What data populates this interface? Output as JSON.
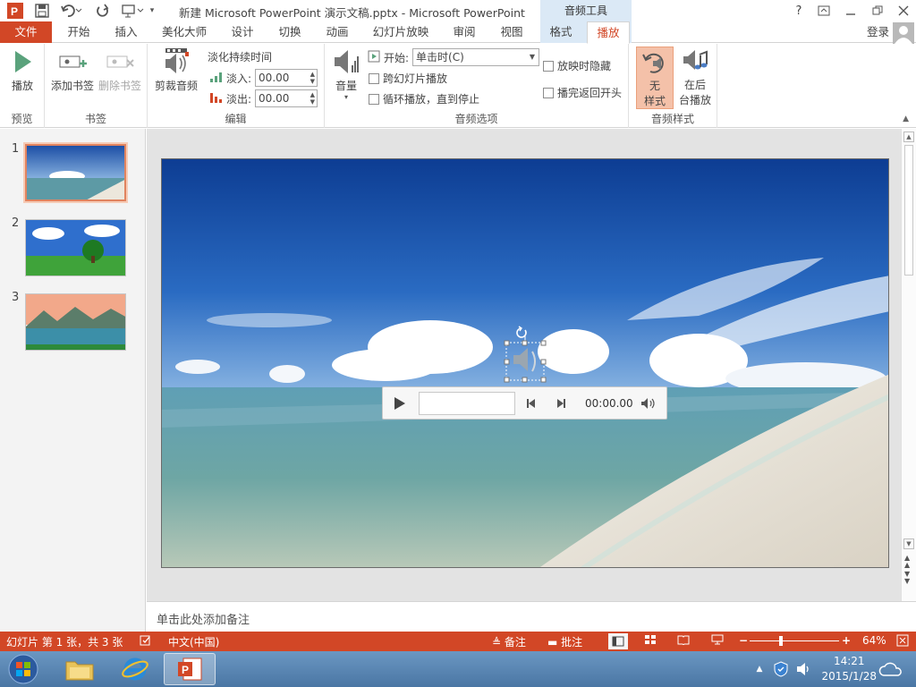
{
  "title_bar": {
    "title": "新建 Microsoft PowerPoint 演示文稿.pptx - Microsoft PowerPoint",
    "context_group": "音频工具",
    "help": "?",
    "login": "登录"
  },
  "tabs": [
    "文件",
    "开始",
    "插入",
    "美化大师",
    "设计",
    "切换",
    "动画",
    "幻灯片放映",
    "审阅",
    "视图",
    "格式",
    "播放"
  ],
  "ribbon": {
    "preview": {
      "play": "播放",
      "group": "预览"
    },
    "bookmarks": {
      "add": "添加书签",
      "remove": "删除书签",
      "group": "书签"
    },
    "editing": {
      "trim": "剪裁音频",
      "fade_duration": "淡化持续时间",
      "fade_in_label": "淡入:",
      "fade_in_value": "00.00",
      "fade_out_label": "淡出:",
      "fade_out_value": "00.00",
      "group": "编辑"
    },
    "audio_options": {
      "volume": "音量",
      "start_label": "开始:",
      "start_value": "单击时(C)",
      "play_across": "跨幻灯片播放",
      "loop": "循环播放，直到停止",
      "hide": "放映时隐藏",
      "rewind": "播完返回开头",
      "group": "音频选项"
    },
    "audio_styles": {
      "no_style_1": "无",
      "no_style_2": "样式",
      "background_1": "在后",
      "background_2": "台播放",
      "group": "音频样式"
    }
  },
  "slides": [
    {
      "num": "1"
    },
    {
      "num": "2"
    },
    {
      "num": "3"
    }
  ],
  "player": {
    "time": "00:00.00"
  },
  "notes_placeholder": "单击此处添加备注",
  "status_bar": {
    "slide_info": "幻灯片 第 1 张，共 3 张",
    "language": "中文(中国)",
    "notes": "备注",
    "comments": "批注",
    "zoom": "64%",
    "zoom_fraction": 0.35
  },
  "taskbar": {
    "time": "14:21",
    "date": "2015/1/28"
  },
  "colors": {
    "accent": "#d24726",
    "context_tab": "#dbe9f6"
  }
}
